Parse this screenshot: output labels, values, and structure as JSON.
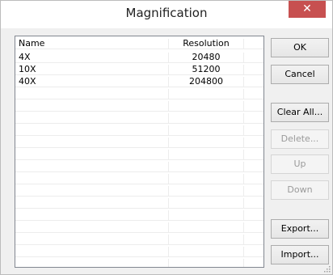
{
  "window": {
    "title": "Magnification",
    "close_glyph": "✕"
  },
  "table": {
    "columns": [
      "Name",
      "Resolution"
    ],
    "rows": [
      {
        "name": "4X",
        "resolution": "20480"
      },
      {
        "name": "10X",
        "resolution": "51200"
      },
      {
        "name": "40X",
        "resolution": "204800"
      }
    ]
  },
  "buttons": {
    "ok": "OK",
    "cancel": "Cancel",
    "clear_all": "Clear All...",
    "delete": "Delete...",
    "up": "Up",
    "down": "Down",
    "export": "Export...",
    "import": "Import..."
  },
  "colors": {
    "close_bg": "#c75050",
    "disabled_text": "#9a9a9a"
  }
}
